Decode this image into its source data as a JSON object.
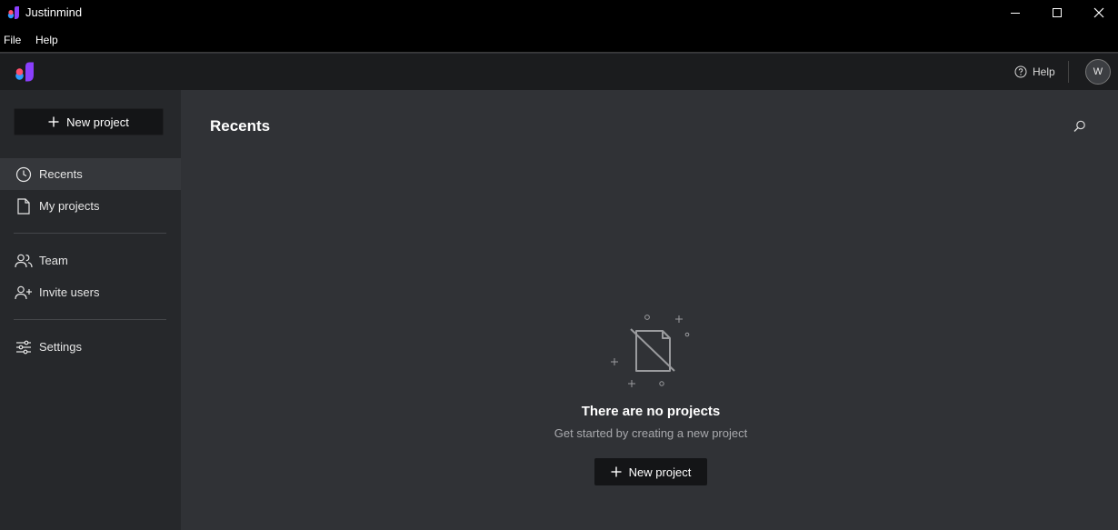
{
  "window": {
    "title": "Justinmind"
  },
  "menu": {
    "items": [
      "File",
      "Help"
    ]
  },
  "header": {
    "help_label": "Help",
    "avatar_initial": "W"
  },
  "sidebar": {
    "new_project_label": "New project",
    "items": [
      {
        "label": "Recents",
        "icon": "clock-icon",
        "active": true
      },
      {
        "label": "My projects",
        "icon": "document-icon",
        "active": false
      },
      {
        "label": "Team",
        "icon": "team-icon",
        "active": false
      },
      {
        "label": "Invite users",
        "icon": "add-user-icon",
        "active": false
      },
      {
        "label": "Settings",
        "icon": "sliders-icon",
        "active": false
      }
    ]
  },
  "main": {
    "title": "Recents",
    "empty_state": {
      "title": "There are no projects",
      "subtitle": "Get started by creating a new project",
      "button_label": "New project"
    }
  },
  "colors": {
    "brand_purple": "#8a3ffc",
    "brand_pink": "#ff4f6d",
    "brand_blue": "#2d9cff",
    "active_nav_bg": "#35373b"
  }
}
